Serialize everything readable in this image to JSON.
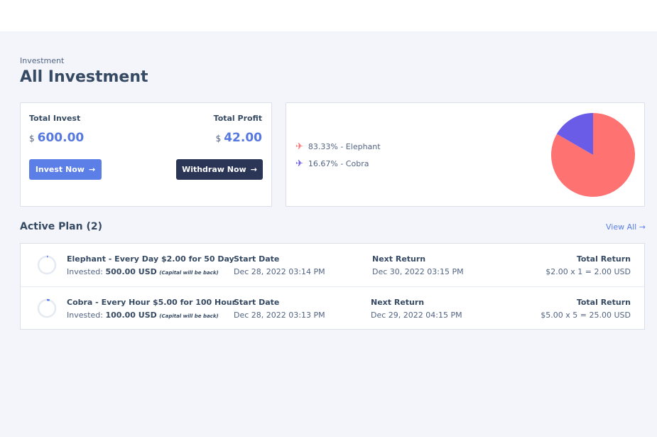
{
  "header": {
    "breadcrumb": "Investment",
    "title": "All Investment"
  },
  "summary": {
    "total_invest_label": "Total Invest",
    "total_invest_currency": "$",
    "total_invest_value": "600.00",
    "total_profit_label": "Total Profit",
    "total_profit_currency": "$",
    "total_profit_value": "42.00",
    "invest_button": "Invest Now",
    "withdraw_button": "Withdraw Now",
    "arrow": "→"
  },
  "chart_data": {
    "type": "pie",
    "slices": [
      {
        "label": "83.33% - Elephant",
        "name": "Elephant",
        "value": 83.33,
        "color": "#ff7272"
      },
      {
        "label": "16.67% - Cobra",
        "name": "Cobra",
        "value": 16.67,
        "color": "#6b5ce7"
      }
    ]
  },
  "active_plans": {
    "title": "Active Plan (2)",
    "view_all": "View All →",
    "invested_label": "Invested:",
    "capital_note": "(Capital will be back)",
    "start_label": "Start Date",
    "next_label": "Next Return",
    "total_label": "Total Return",
    "items": [
      {
        "name": "Elephant - Every Day $2.00 for 50 Day",
        "invested": "500.00 USD",
        "start": "Dec 28, 2022 03:14 PM",
        "next": "Dec 30, 2022 03:15 PM",
        "total": "$2.00 x 1 = 2.00 USD",
        "progress": 0.02
      },
      {
        "name": "Cobra - Every Hour $5.00 for 100 Hour",
        "invested": "100.00 USD",
        "start": "Dec 28, 2022 03:13 PM",
        "next": "Dec 29, 2022 04:15 PM",
        "total": "$5.00 x 5 = 25.00 USD",
        "progress": 0.05
      }
    ]
  },
  "colors": {
    "accent": "#5b7fe6",
    "dark_button": "#2b3556",
    "ring_track": "#e5e9f2"
  },
  "icons": {
    "legend": "plane-icon",
    "button_arrow": "arrow-right-icon"
  }
}
